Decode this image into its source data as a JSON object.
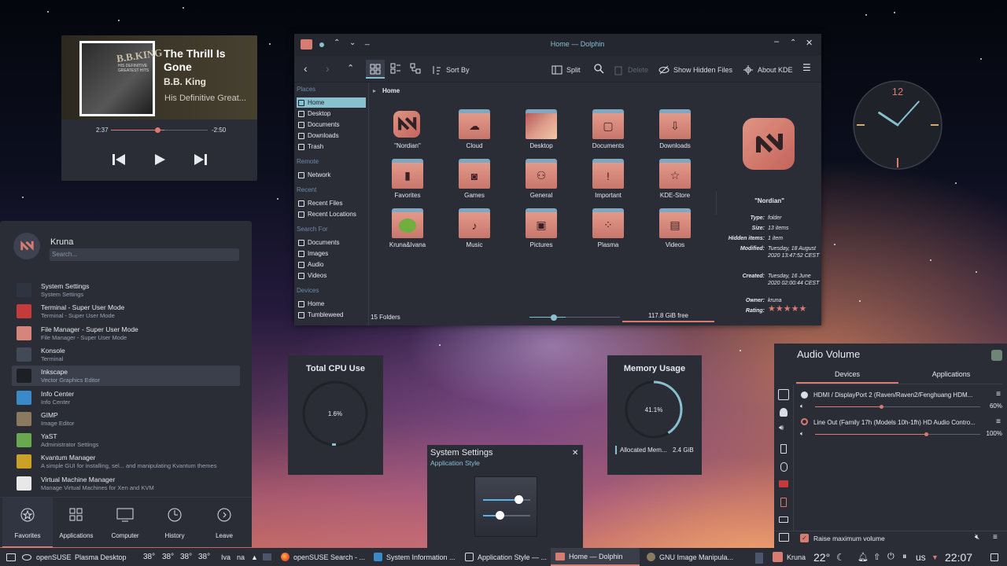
{
  "media": {
    "album_art_title": "B.B.KING",
    "album_art_sub": "HIS DEFINITIVE GREATEST HITS",
    "title": "The Thrill Is Gone",
    "artist": "B.B. King",
    "album": "His Definitive Great...",
    "elapsed": "2:37",
    "remaining": "-2:50",
    "progress": 0.55
  },
  "dolphin": {
    "title": "Home — Dolphin",
    "toolbar": {
      "sort_by": "Sort By",
      "split": "Split",
      "delete": "Delete",
      "show_hidden": "Show Hidden Files",
      "about": "About KDE"
    },
    "breadcrumb": "Home",
    "places": {
      "places_header": "Places",
      "places": [
        "Home",
        "Desktop",
        "Documents",
        "Downloads",
        "Trash"
      ],
      "remote_header": "Remote",
      "remote": [
        "Network"
      ],
      "recent_header": "Recent",
      "recent": [
        "Recent Files",
        "Recent Locations"
      ],
      "search_header": "Search For",
      "search": [
        "Documents",
        "Images",
        "Audio",
        "Videos"
      ],
      "devices_header": "Devices",
      "devices": [
        "Home",
        "Tumbleweed"
      ]
    },
    "folders": [
      {
        "label": "\"Nordian\"",
        "glyph": ""
      },
      {
        "label": "Cloud",
        "glyph": "☁"
      },
      {
        "label": "Desktop",
        "glyph": ""
      },
      {
        "label": "Documents",
        "glyph": "▢"
      },
      {
        "label": "Downloads",
        "glyph": "⇩"
      },
      {
        "label": "Favorites",
        "glyph": "▮"
      },
      {
        "label": "Games",
        "glyph": "◙"
      },
      {
        "label": "General",
        "glyph": "⚇"
      },
      {
        "label": "Important",
        "glyph": "!"
      },
      {
        "label": "KDE-Store",
        "glyph": "☆"
      },
      {
        "label": "Kruna&Ivana",
        "glyph": ""
      },
      {
        "label": "Music",
        "glyph": "♪"
      },
      {
        "label": "Pictures",
        "glyph": "▣"
      },
      {
        "label": "Plasma",
        "glyph": "⁘"
      },
      {
        "label": "Videos",
        "glyph": "▤"
      }
    ],
    "info": {
      "name": "\"Nordian\"",
      "rows": [
        {
          "k": "Type:",
          "v": "folder"
        },
        {
          "k": "Size:",
          "v": "13 items"
        },
        {
          "k": "Hidden items:",
          "v": "1 item"
        },
        {
          "k": "Modified:",
          "v": "Tuesday, 18 August 2020 13:47:52 CEST"
        },
        {
          "k": "Created:",
          "v": "Tuesday, 16 June 2020 02:00:44 CEST"
        },
        {
          "k": "Owner:",
          "v": "kruna"
        },
        {
          "k": "Rating:",
          "v": "★★★★★"
        }
      ]
    },
    "status": {
      "folders": "15 Folders",
      "free": "117.8 GiB free",
      "zoom": 0.4
    }
  },
  "clock": {
    "twelve": "12",
    "hour": 10,
    "minute": 7
  },
  "cpu": {
    "title": "Total CPU Use",
    "value": "1.6%",
    "fraction": 0.016
  },
  "memory": {
    "title": "Memory Usage",
    "value": "41.1%",
    "fraction": 0.411,
    "label": "Allocated Mem...",
    "amount": "2.4 GiB"
  },
  "syset": {
    "title": "System Settings",
    "subtitle": "Application Style"
  },
  "launcher": {
    "user": "Kruna",
    "search_placeholder": "Search...",
    "apps": [
      {
        "name": "System Settings",
        "desc": "System Settings",
        "color": "#2e3440"
      },
      {
        "name": "Terminal - Super User Mode",
        "desc": "Terminal - Super User Mode",
        "color": "#c43b3b"
      },
      {
        "name": "File Manager - Super User Mode",
        "desc": "File Manager - Super User Mode",
        "color": "#d7857a"
      },
      {
        "name": "Konsole",
        "desc": "Terminal",
        "color": "#434a57"
      },
      {
        "name": "Inkscape",
        "desc": "Vector Graphics Editor",
        "color": "#1d1f24"
      },
      {
        "name": "Info Center",
        "desc": "Info Center",
        "color": "#3a89c9"
      },
      {
        "name": "GIMP",
        "desc": "Image Editor",
        "color": "#8a7a5f"
      },
      {
        "name": "YaST",
        "desc": "Administrator Settings",
        "color": "#6aa84f"
      },
      {
        "name": "Kvantum Manager",
        "desc": "A simple GUI for installing, sel... and manipulating Kvantum themes",
        "color": "#c9a227"
      },
      {
        "name": "Virtual Machine Manager",
        "desc": "Manage Virtual Machines for Xen and KVM",
        "color": "#e8e8e8"
      }
    ],
    "tabs": [
      "Favorites",
      "Applications",
      "Computer",
      "History",
      "Leave"
    ]
  },
  "audio": {
    "title": "Audio Volume",
    "tabs": [
      "Devices",
      "Applications"
    ],
    "devices": [
      {
        "name": "HDMI / DisplayPort 2 (Raven/Raven2/Fenghuang HDM...",
        "pct": "60%",
        "level": 0.4
      },
      {
        "name": "Line Out (Family 17h (Models 10h-1fh) HD Audio Contro...",
        "pct": "100%",
        "level": 0.67
      }
    ],
    "raise_max": "Raise maximum volume"
  },
  "taskbar": {
    "left": "openSUSE",
    "desktop": "Plasma Desktop",
    "temps": [
      "38°",
      "38°",
      "38°",
      "38°"
    ],
    "users": [
      "Iva",
      "na"
    ],
    "tasks": [
      "openSUSE Search - ...",
      "System Information ...",
      "Application Style — ...",
      "Home — Dolphin",
      "GNU Image Manipula..."
    ],
    "user": "Kruna",
    "weather": "22°",
    "layout": "us",
    "time": "22:07"
  }
}
